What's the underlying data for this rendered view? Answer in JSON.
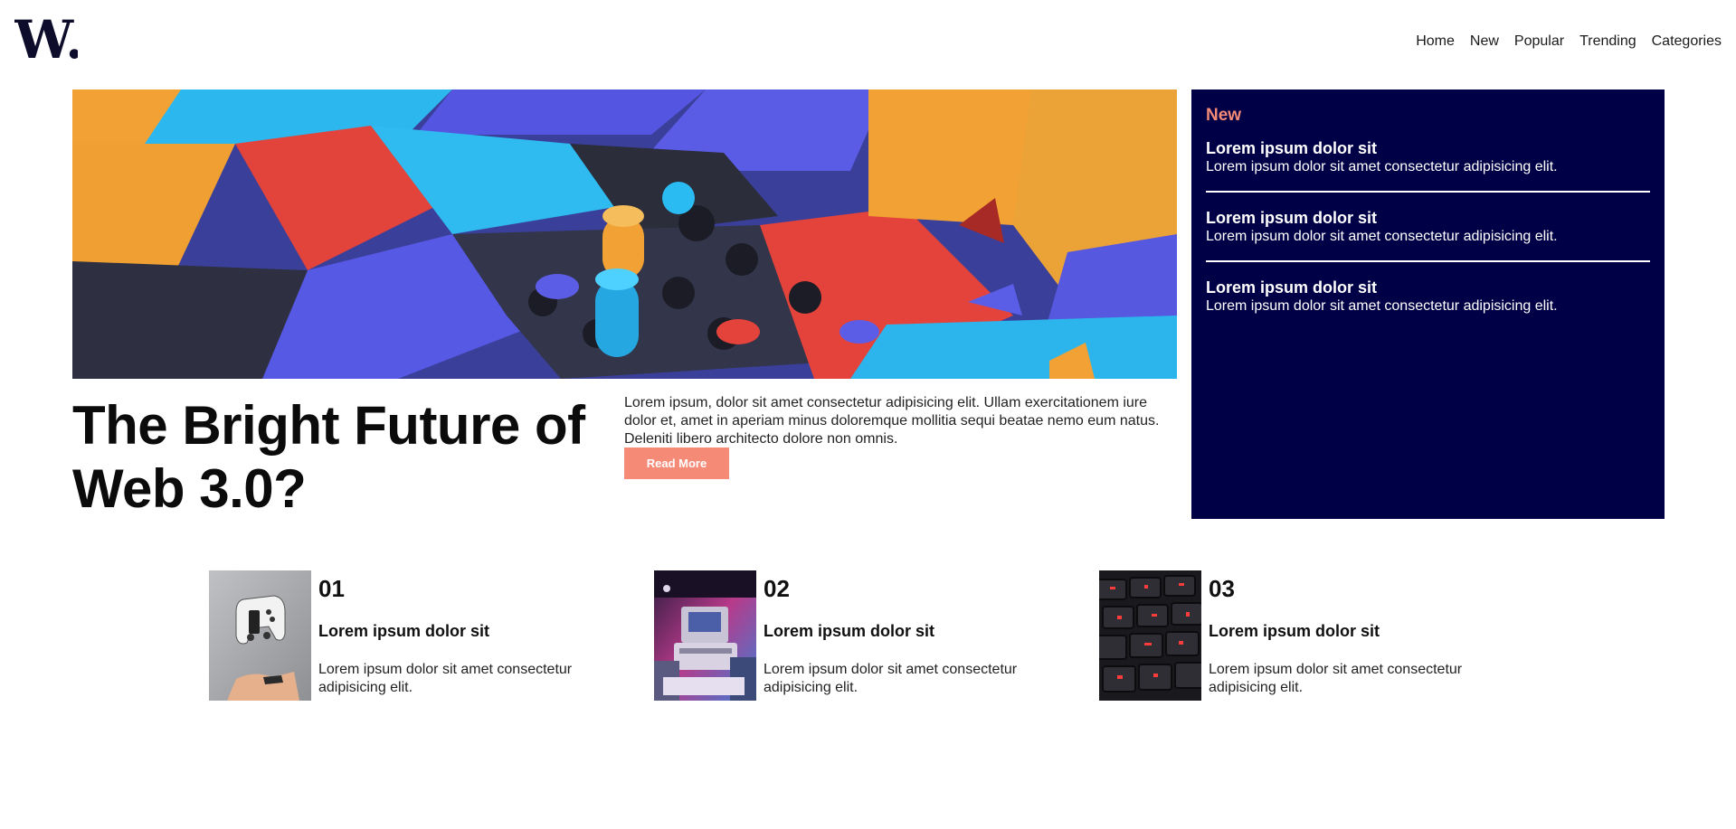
{
  "header": {
    "logo_text": "W.",
    "nav": [
      {
        "label": "Home"
      },
      {
        "label": "New"
      },
      {
        "label": "Popular"
      },
      {
        "label": "Trending"
      },
      {
        "label": "Categories"
      }
    ]
  },
  "hero": {
    "title": "The Bright Future of Web 3.0?",
    "description": "Lorem ipsum, dolor sit amet consectetur adipisicing elit. Ullam exercitationem iure dolor et, amet in aperiam minus doloremque mollitia sequi beatae nemo eum natus. Deleniti libero architecto dolore non omnis.",
    "cta_label": "Read More"
  },
  "new_panel": {
    "heading": "New",
    "items": [
      {
        "title": "Lorem ipsum dolor sit",
        "desc": "Lorem ipsum dolor sit amet consectetur adipisicing elit."
      },
      {
        "title": "Lorem ipsum dolor sit",
        "desc": "Lorem ipsum dolor sit amet consectetur adipisicing elit."
      },
      {
        "title": "Lorem ipsum dolor sit",
        "desc": "Lorem ipsum dolor sit amet consectetur adipisicing elit."
      }
    ]
  },
  "cards": [
    {
      "number": "01",
      "title": "Lorem ipsum dolor sit",
      "desc": "Lorem ipsum dolor sit amet consectetur adipisicing elit.",
      "image": "gamepad-photo"
    },
    {
      "number": "02",
      "title": "Lorem ipsum dolor sit",
      "desc": "Lorem ipsum dolor sit amet consectetur adipisicing elit.",
      "image": "retro-computer-photo"
    },
    {
      "number": "03",
      "title": "Lorem ipsum dolor sit",
      "desc": "Lorem ipsum dolor sit amet consectetur adipisicing elit.",
      "image": "keyboard-photo"
    }
  ],
  "colors": {
    "accent": "#f58a77",
    "panel_bg": "#000046",
    "text": "#0b0b0b"
  }
}
